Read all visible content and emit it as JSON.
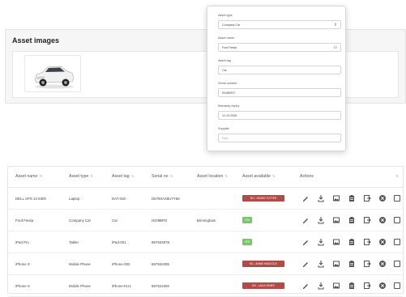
{
  "asset_images": {
    "title": "Asset images",
    "image_name": "car-photo"
  },
  "form": {
    "fields": [
      {
        "label": "Asset type",
        "value": "Company Car",
        "trail_icon": "select-arrow",
        "trail": "⇕",
        "placeholder": false
      },
      {
        "label": "Asset name",
        "value": "Ford Fiesta",
        "trail_icon": "clock-icon",
        "trail": "⊙",
        "placeholder": false
      },
      {
        "label": "Asset tag",
        "value": "Car",
        "trail_icon": "",
        "trail": "",
        "placeholder": false
      },
      {
        "label": "Serial number",
        "value": "ISO8BPO",
        "trail_icon": "",
        "trail": "",
        "placeholder": false
      },
      {
        "label": "Warranty expiry",
        "value": "12.10.2026",
        "trail_icon": "",
        "trail": "",
        "placeholder": false
      },
      {
        "label": "Supplier",
        "value": "Ford",
        "trail_icon": "",
        "trail": "",
        "placeholder": true
      }
    ]
  },
  "table": {
    "columns": {
      "asset_name": "Asset name",
      "asset_type": "Asset type",
      "asset_tag": "Asset tag",
      "serial_no": "Serial no",
      "asset_location": "Asset location",
      "asset_available": "Asset available",
      "actions": "Actions"
    },
    "rows": [
      {
        "name": "DELL XPS 13 9300",
        "type": "Laptop",
        "tag": "DAT-020",
        "serial": "D6760AX8U7Y66",
        "location": "",
        "status": "NO - HEARD TUTTER",
        "status_color": "#b24a48"
      },
      {
        "name": "Ford Fiesta",
        "type": "Company Car",
        "tag": "Car",
        "serial": "ISO8BPO",
        "location": "Birmingham",
        "status": "YES",
        "status_color": "#7cc56f"
      },
      {
        "name": "iPad Pro",
        "type": "Tablet",
        "tag": "iPad-001",
        "serial": "867934978",
        "location": "",
        "status": "YES",
        "status_color": "#7cc56f"
      },
      {
        "name": "iPhone X",
        "type": "Mobile Phone",
        "tag": "iPhone-002",
        "serial": "867934385",
        "location": "",
        "status": "NO - ANNIE HANCOCK",
        "status_color": "#b24a48"
      },
      {
        "name": "iPhone X",
        "type": "Mobile Phone",
        "tag": "iPhone-KU1",
        "serial": "867524392",
        "location": "",
        "status": "NO - LAILA JONES",
        "status_color": "#b24a48"
      }
    ],
    "action_icons": [
      "pencil-icon",
      "download-icon",
      "image-icon",
      "clipboard-icon",
      "export-icon",
      "close-circle-icon"
    ]
  }
}
